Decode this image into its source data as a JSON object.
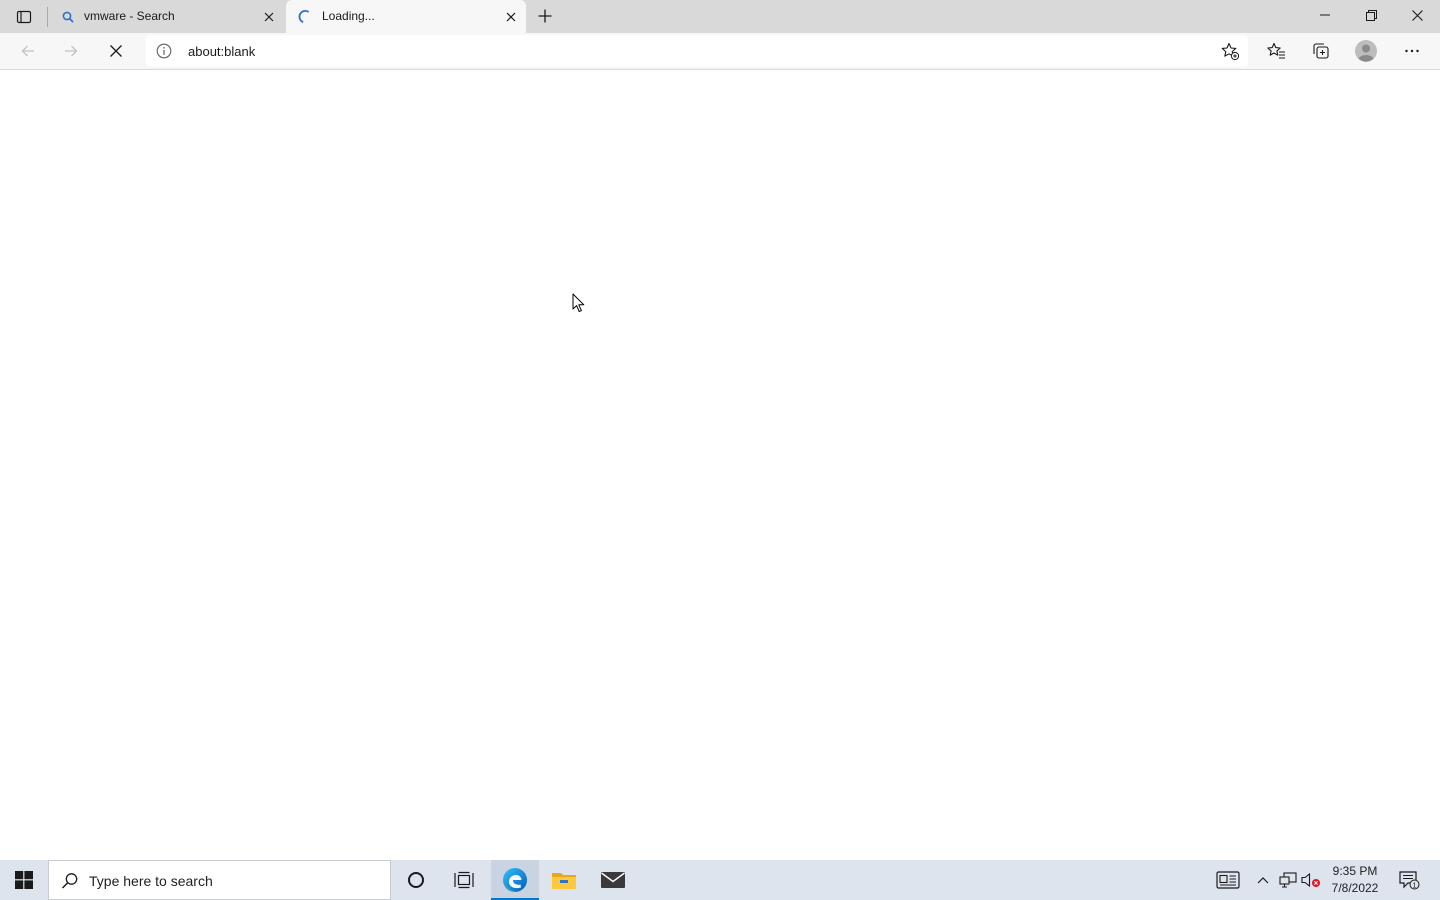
{
  "browser": {
    "tabs": [
      {
        "title": "vmware - Search",
        "icon": "search-icon",
        "active": false
      },
      {
        "title": "Loading...",
        "icon": "loading-spinner-icon",
        "active": true
      }
    ],
    "address_bar": {
      "url": "about:blank",
      "site_info_icon": "info-icon"
    },
    "toolbar_icons": [
      "back-icon",
      "forward-icon",
      "stop-loading-icon",
      "add-favorite-icon",
      "favorites-icon",
      "collections-icon",
      "profile-icon",
      "more-icon"
    ]
  },
  "taskbar": {
    "search_placeholder": "Type here to search",
    "pinned_apps": [
      "cortana-icon",
      "task-view-icon",
      "edge-icon",
      "file-explorer-icon",
      "mail-icon"
    ],
    "clock": {
      "time": "9:35 PM",
      "date": "7/8/2022"
    },
    "notification_count": "1"
  },
  "colors": {
    "tabstrip_bg": "#d9d9d9",
    "toolbar_bg": "#f7f7f7",
    "taskbar_bg": "#dde4ee",
    "accent": "#0078d4"
  }
}
